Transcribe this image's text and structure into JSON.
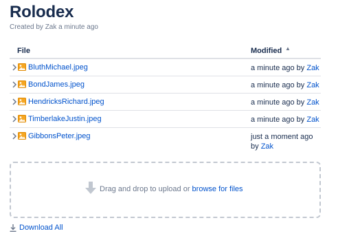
{
  "page": {
    "title": "Rolodex",
    "byline": "Created by Zak a minute ago"
  },
  "table": {
    "col_file": "File",
    "col_modified": "Modified",
    "rows": [
      {
        "name": "BluthMichael.jpeg",
        "modified_prefix": "a minute ago by",
        "user": "Zak"
      },
      {
        "name": "BondJames.jpeg",
        "modified_prefix": "a minute ago by",
        "user": "Zak"
      },
      {
        "name": "HendricksRichard.jpeg",
        "modified_prefix": "a minute ago by",
        "user": "Zak"
      },
      {
        "name": "TimberlakeJustin.jpeg",
        "modified_prefix": "a minute ago by",
        "user": "Zak"
      },
      {
        "name": "GibbonsPeter.jpeg",
        "modified_prefix": "just a moment ago by",
        "user": "Zak"
      }
    ]
  },
  "dropzone": {
    "text": "Drag and drop to upload or",
    "link": "browse for files"
  },
  "download": {
    "label": "Download All"
  },
  "colors": {
    "link": "#0052CC",
    "text": "#172B4D",
    "muted": "#6B778C",
    "border": "#DFE1E6",
    "image_icon": "#F5A623"
  },
  "icons": {
    "expand": "chevron-right-icon",
    "file": "image-file-icon",
    "upload": "upload-arrow-icon",
    "download": "download-icon",
    "sort": "sort-ascending-icon"
  }
}
